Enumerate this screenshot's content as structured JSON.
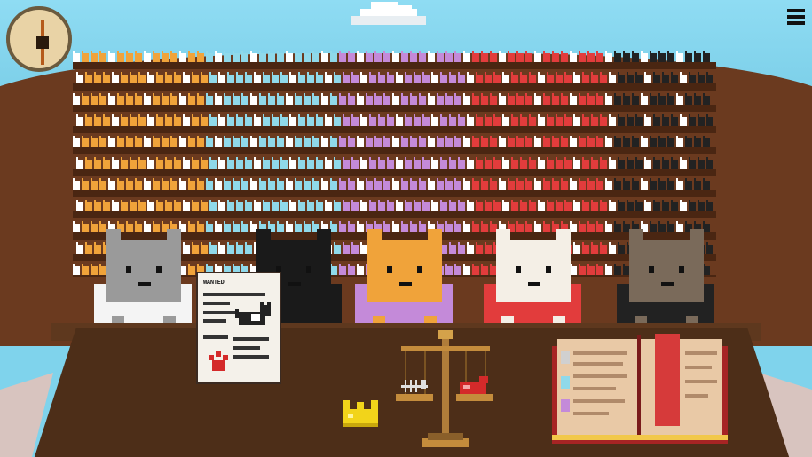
{
  "hud": {
    "clock_icon": "clock-icon",
    "menu_icon": "hamburger-menu-icon"
  },
  "courtroom": {
    "poster": {
      "title": "WANTED",
      "icon_left": "cat-silhouette-icon",
      "icon_right": "paw-print-icon"
    },
    "evidence": {
      "crown": "crown-icon",
      "scale": "scale-of-justice-icon",
      "fish_bones": "fish-bones-icon",
      "meat": "meat-icon",
      "book": "law-book-icon"
    },
    "judges": [
      {
        "name": "grey-cat-judge",
        "fur": "#9a9a9a",
        "robe": "#f4f4f4"
      },
      {
        "name": "black-cat-judge",
        "fur": "#1a1a1a",
        "robe": "#1a1a1a"
      },
      {
        "name": "orange-black-cat-judge",
        "fur": "#f0a33a",
        "robe": "#c48ad9"
      },
      {
        "name": "siamese-cat-judge",
        "fur": "#f4efe6",
        "robe": "#e23c3c"
      },
      {
        "name": "brown-cat-judge",
        "fur": "#7a6a5a",
        "robe": "#222222"
      }
    ]
  },
  "colors": {
    "sky": "#7fd3ec",
    "wood": "#6b3a1f",
    "desk": "#4d2e18",
    "crowd_orange": "#f0a33a",
    "crowd_blue": "#8fd9ea",
    "crowd_purple": "#c48ad9",
    "crowd_red": "#e23c3c"
  }
}
